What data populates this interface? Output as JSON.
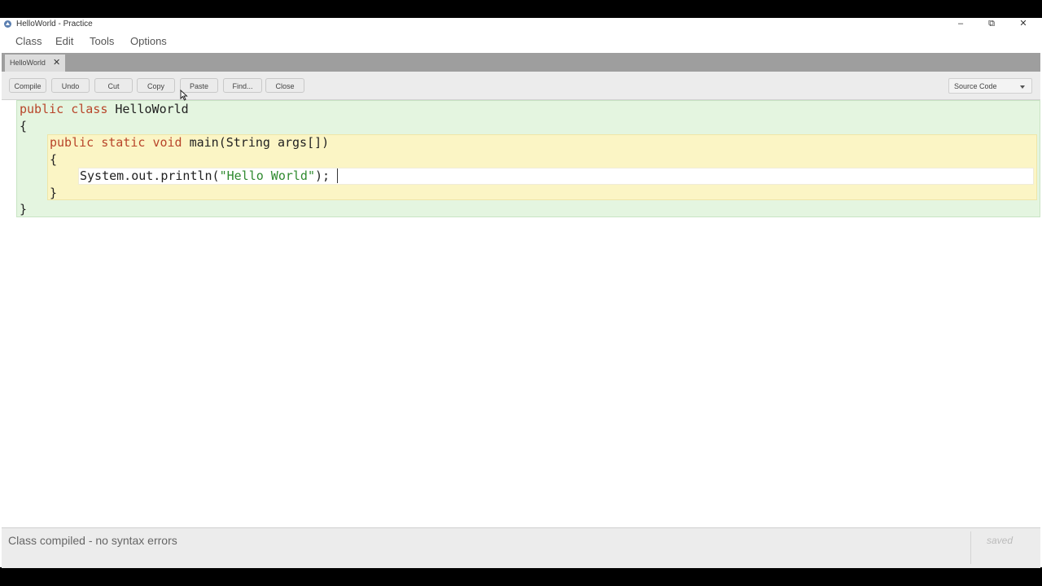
{
  "window": {
    "title": "HelloWorld - Practice",
    "controls": {
      "minimize": "–",
      "maximize": "⧉",
      "close": "✕"
    }
  },
  "menu": [
    "Class",
    "Edit",
    "Tools",
    "Options"
  ],
  "tabs": [
    {
      "label": "HelloWorld",
      "close": "✕"
    }
  ],
  "toolbar": {
    "buttons": [
      "Compile",
      "Undo",
      "Cut",
      "Copy",
      "Paste",
      "Find...",
      "Close"
    ],
    "view_select": "Source Code"
  },
  "code": {
    "line1_kw1": "public",
    "line1_kw2": "class",
    "line1_name": "HelloWorld",
    "line2": "{",
    "line3_kw1": "public",
    "line3_kw2": "static",
    "line3_kw3": "void",
    "line3_rest": "main(String args[])",
    "line4": "{",
    "line5_pre": "System.out.println(",
    "line5_str": "\"Hello World\"",
    "line5_post": ");",
    "line6": "}",
    "line7": "}"
  },
  "status": {
    "message": "Class compiled - no syntax errors",
    "saved": "saved"
  },
  "colors": {
    "class_scope": "#e4f5e0",
    "method_scope": "#fbf5c5",
    "keyword": "#b8452a",
    "string": "#2f8a2f"
  }
}
